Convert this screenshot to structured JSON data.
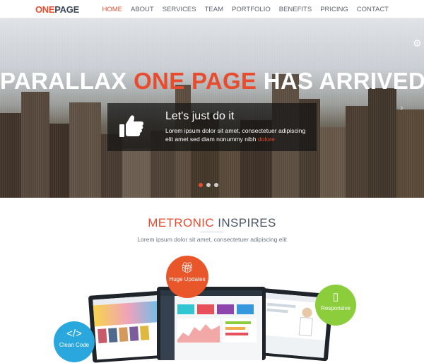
{
  "nav": {
    "logo_part1": "ONE",
    "logo_part2": "PAGE",
    "items": [
      "HOME",
      "ABOUT",
      "SERVICES",
      "TEAM",
      "PORTFOLIO",
      "BENEFITS",
      "PRICING",
      "CONTACT"
    ]
  },
  "hero": {
    "title_part1": "PARALLAX ",
    "title_highlight": "ONE PAGE",
    "title_part2": " HAS ARRIVED",
    "caption_title": "Let's just do it",
    "caption_text": "Lorem ipsum dolor sit amet, consectetuer adipiscing elit amet sed diam nonummy nibh ",
    "caption_link": "dolore",
    "slider_dots": 3,
    "active_dot": 0
  },
  "section": {
    "title_highlight": "METRONIC",
    "title_rest": " INSPIRES",
    "subtitle": "Lorem ipsum dolor sit amet, consectetuer adipiscing elit"
  },
  "features": {
    "huge_updates": "Huge Updates",
    "responsive": "Responsive",
    "clean_code": "Clean Code"
  },
  "colors": {
    "accent": "#e84c2e",
    "orange_circle": "#e8562a",
    "green_circle": "#8bcd3a",
    "blue_circle": "#2aa8dd"
  },
  "icons": {
    "settings": "gear-icon",
    "caption": "thumbs-up-icon",
    "huge_updates": "gift-icon",
    "responsive": "mobile-icon",
    "clean_code": "code-icon"
  }
}
